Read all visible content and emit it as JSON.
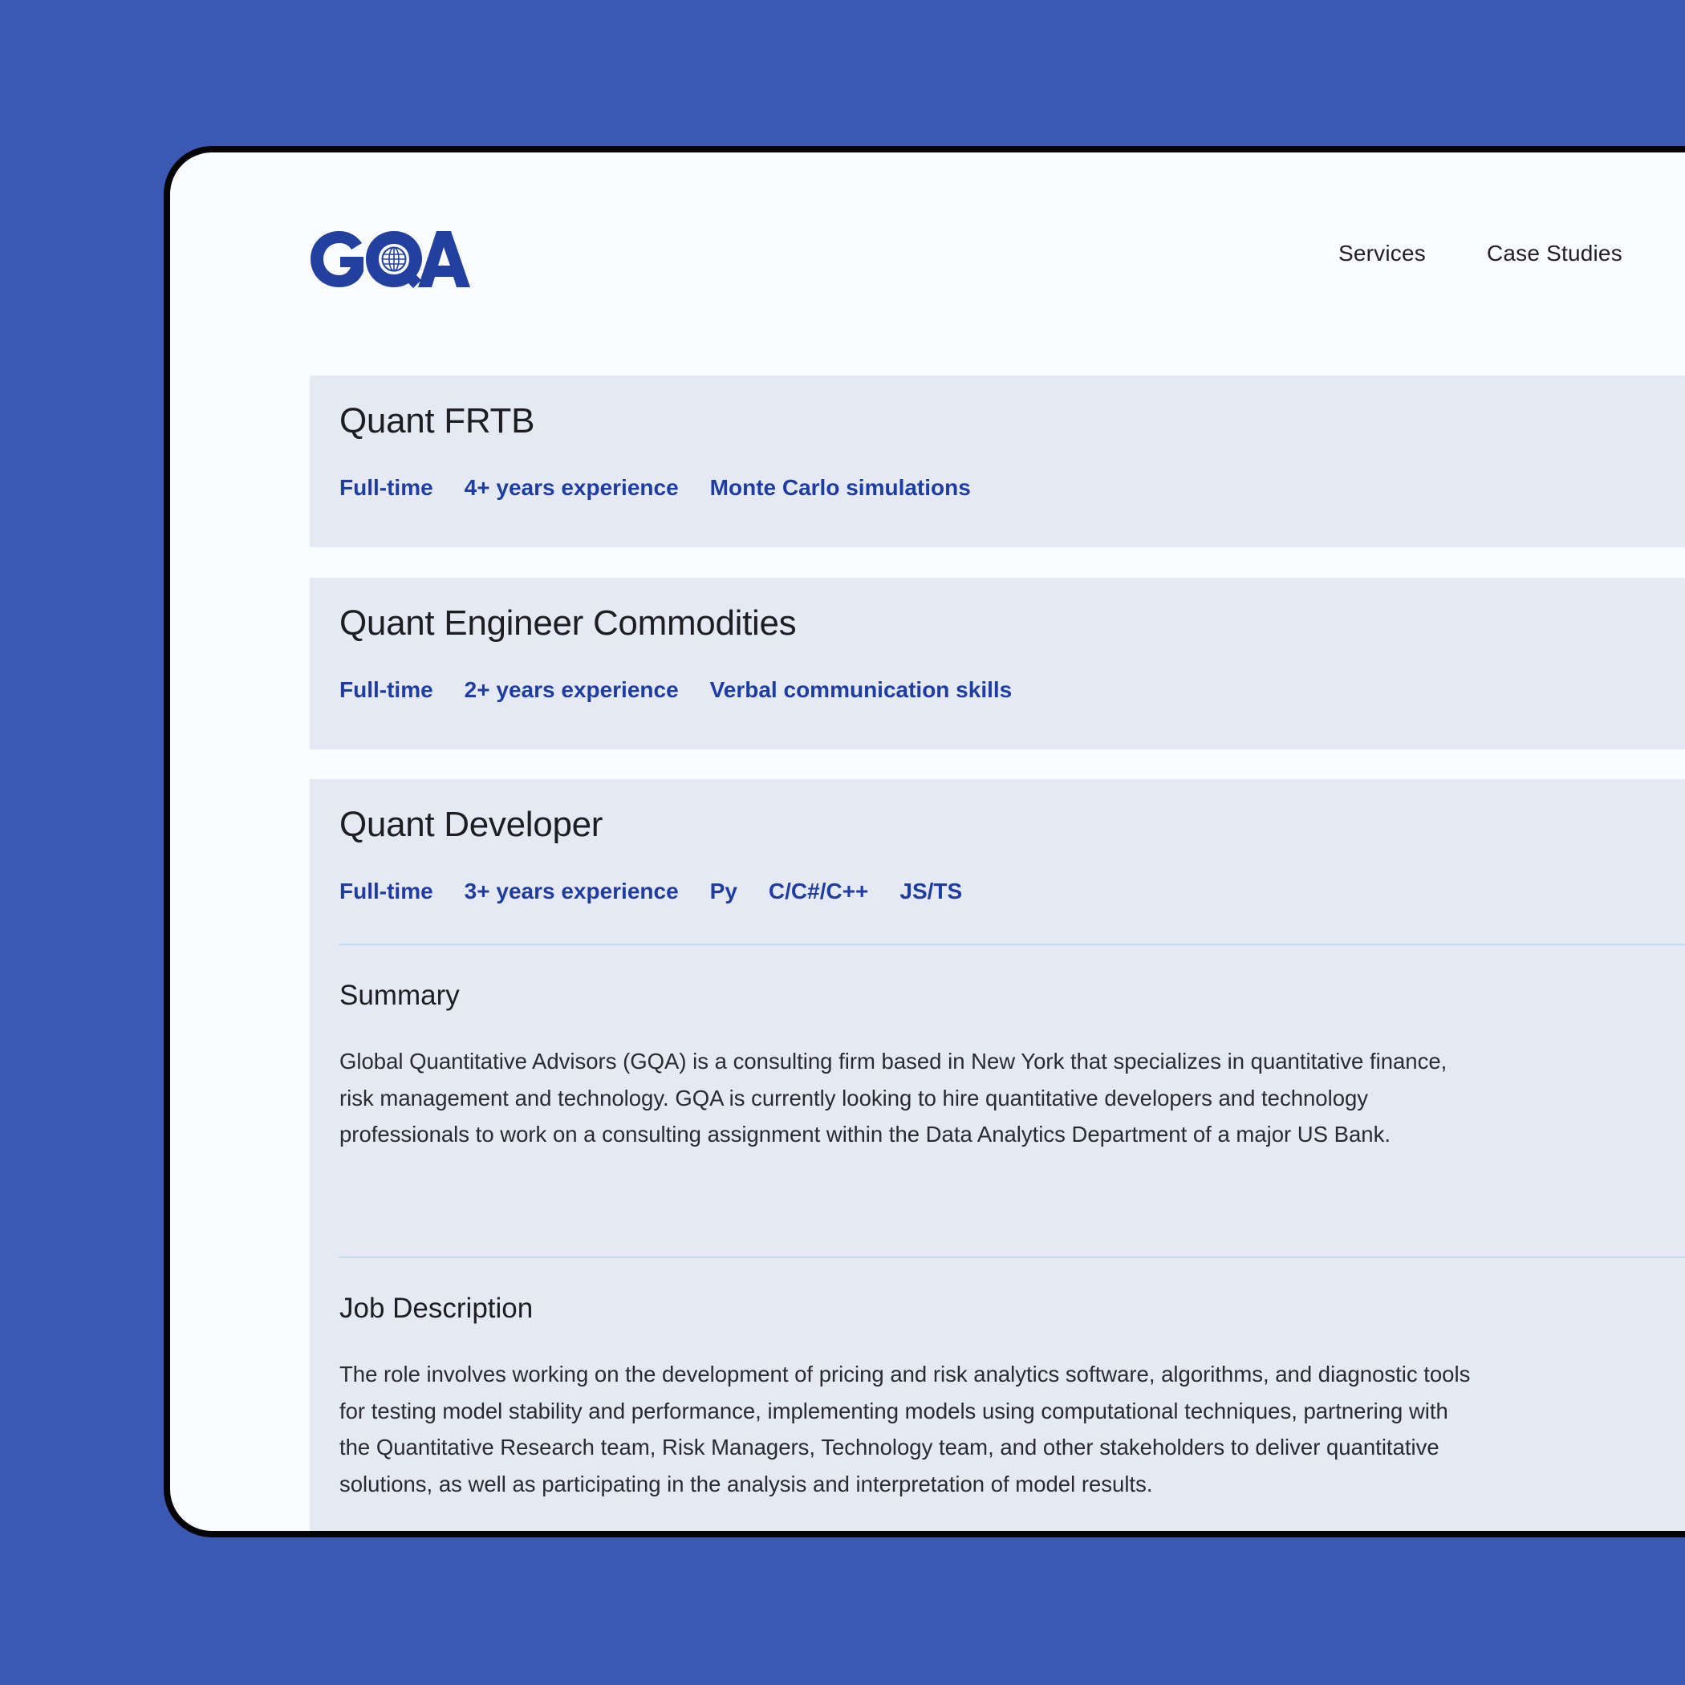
{
  "brand": {
    "logo_text": "GQA",
    "logo_color": "#23409e",
    "background_color": "#3b58b2"
  },
  "nav": {
    "items": [
      {
        "label": "Services"
      },
      {
        "label": "Case Studies"
      }
    ]
  },
  "jobs": [
    {
      "title": "Quant FRTB",
      "tags": [
        "Full-time",
        "4+ years experience",
        "Monte Carlo simulations"
      ]
    },
    {
      "title": "Quant Engineer Commodities",
      "tags": [
        "Full-time",
        "2+ years experience",
        "Verbal communication skills"
      ]
    },
    {
      "title": "Quant Developer",
      "tags": [
        "Full-time",
        "3+ years experience",
        "Py",
        "C/C#/C++",
        "JS/TS"
      ],
      "sections": [
        {
          "heading": "Summary",
          "body": "Global Quantitative Advisors (GQA) is a consulting firm based in New York that specializes in quantitative finance, risk management and technology. GQA is currently looking to hire quantitative developers and technology professionals to work on a consulting assignment within the Data Analytics Department of a major US Bank."
        },
        {
          "heading": "Job Description",
          "body": "The role involves working on the development of pricing and risk analytics software, algorithms, and diagnostic tools for testing model stability and performance, implementing models using computational techniques, partnering with the Quantitative Research team, Risk Managers, Technology team, and other stakeholders to deliver quantitative solutions, as well as participating in the analysis and interpretation of model results."
        }
      ]
    }
  ]
}
